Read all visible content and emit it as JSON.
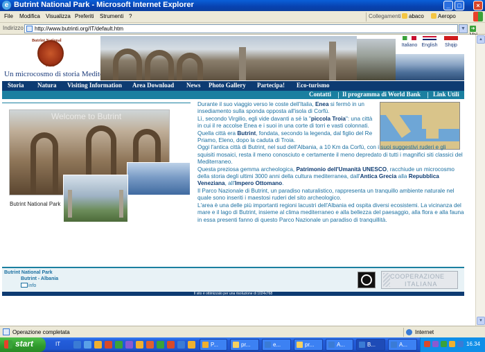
{
  "window": {
    "title": "Butrint National Park - Microsoft Internet Explorer",
    "buttons": {
      "minimize": "_",
      "maximize": "□",
      "close": "×"
    }
  },
  "menu": {
    "items": [
      "File",
      "Modifica",
      "Visualizza",
      "Preferiti",
      "Strumenti",
      "?"
    ],
    "links_label": "Collegamenti",
    "links": [
      "abaco",
      "Aeropo"
    ]
  },
  "address": {
    "label": "Indirizzo",
    "url": "http://www.butrinti.org/IT/default.htm",
    "go": "Vai"
  },
  "site": {
    "logo_text_top": "Butrint National",
    "logo_text_bottom": "Park",
    "tagline": "Un microcosmo di storia Mediterranea",
    "languages": [
      {
        "label": "Italiano",
        "color": "#3aa23a"
      },
      {
        "label": "English",
        "color": "#c8102e"
      },
      {
        "label": "Shqip",
        "color": "#d01c1c"
      }
    ],
    "nav": [
      "Storia",
      "Natura",
      "Visiting Information",
      "Area Download",
      "News",
      "Photo Gallery",
      "Partecipa!",
      "Eco-turismo"
    ],
    "subnav": [
      "Contatti",
      "Il programma di World Bank",
      "Link Utili"
    ],
    "collage_ghost_text": "Welcome to Butrint",
    "photo_caption": "Butrint National Park",
    "body": {
      "p1_a": "Durante il suo viaggio verso le coste dell'Italia, ",
      "p1_b": "Enea",
      "p1_c": " si fermò in un insediamento sulla sponda opposta all'isola di Corfù.",
      "p2_a": "Lì, secondo Virgilio, egli vide davanti a sé la \"",
      "p2_b": "piccola Troia",
      "p2_c": "\": una città in cui il re accolse Enea e i suoi in una corte di torri e vasti colonnati.",
      "p3_a": "Quella città era ",
      "p3_b": "Butrint",
      "p3_c": ", fondata, secondo la legenda, dal figlio del Re Priamo, Eleno, dopo la caduta di Troia.",
      "p4": "Oggi l'antica città di Butrint, nel sud dell'Albania, a 10 Km da Corfù, con i suoi suggestivi ruderi e gli squisiti mosaici, resta il meno conosciuto e certamente il meno depredato di tutti i magnifici siti classici del Mediterraneo.",
      "p5_a": "Questa preziosa gemma archeologica, ",
      "p5_b": "Patrimonio dell'Umanità UNESCO",
      "p5_c": ", racchiude un microcosmo della storia degli ultimi 3000 anni della cultura mediterranea, dall'",
      "p5_d": "Antica Grecia",
      "p5_e": " alla ",
      "p5_f": "Repubblica Veneziana",
      "p5_g": ", all'",
      "p5_h": "Impero Ottomano",
      "p5_i": ".",
      "p6": "Il Parco Nazionale di Butrint, un paradiso naturalistico, rappresenta un tranquillo ambiente naturale nel quale sono inseriti i maestosi ruderi del sito archeologico.",
      "p7": "L'area è una delle più importanti regioni lacustri dell'Albania ed ospita diversi ecosistemi. La vicinanza del mare e il lago di Butrint, insieme al clima mediterraneo e alla bellezza del paesaggio, alla flora e alla fauna in essa presenti fanno di questo Parco Nazionale un paradiso di tranquillità."
    },
    "footer": {
      "name": "Butrint National Park",
      "location": "Butrint - Albania",
      "info": "info",
      "coop_line1": "COOPERAZIONE",
      "coop_line2": "ITALIANA",
      "resolution": "Il sito è ottimizzato per una risoluzione di 1024x768"
    }
  },
  "status": {
    "text": "Operazione completata",
    "zone": "Internet"
  },
  "taskbar": {
    "start": "start",
    "lang": "IT",
    "tasks": [
      {
        "label": "P...",
        "color": "#f0b030"
      },
      {
        "label": "pr...",
        "color": "#f5d060"
      },
      {
        "label": "e...",
        "color": "#3a7bd5"
      },
      {
        "label": "pr...",
        "color": "#f5d060"
      },
      {
        "label": "A...",
        "color": "#3a7bd5"
      },
      {
        "label": "B...",
        "color": "#3a7bd5"
      },
      {
        "label": "A...",
        "color": "#3a7bd5"
      }
    ],
    "clock": "16.34"
  }
}
